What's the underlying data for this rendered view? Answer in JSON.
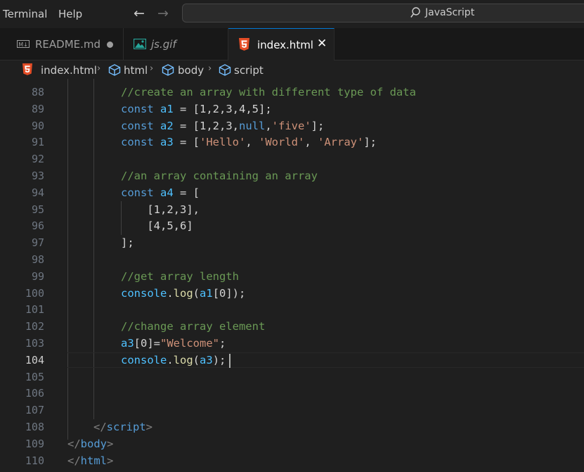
{
  "menu": {
    "terminal": "Terminal",
    "help": "Help"
  },
  "nav": {
    "back": "←",
    "forward": "→"
  },
  "search": {
    "text": "JavaScript"
  },
  "tabs": [
    {
      "label": "README.md",
      "icon": "M↓",
      "state": "modified"
    },
    {
      "label": "js.gif",
      "icon": "image-icon"
    },
    {
      "label": "index.html",
      "icon": "html5-icon",
      "active": true,
      "close": "✕"
    }
  ],
  "breadcrumb": {
    "file": "index.html",
    "items": [
      "html",
      "body",
      "script"
    ],
    "sep": "›"
  },
  "editor": {
    "current_line": "104",
    "lines": [
      {
        "n": "88",
        "parts": [
          {
            "t": "//create an array with different type of data",
            "c": "cm"
          }
        ]
      },
      {
        "n": "89",
        "parts": [
          {
            "t": "const ",
            "c": "kw"
          },
          {
            "t": "a1",
            "c": "vr"
          },
          {
            "t": " = [1,2,3,4,5];",
            "c": "tx"
          }
        ]
      },
      {
        "n": "90",
        "parts": [
          {
            "t": "const ",
            "c": "kw"
          },
          {
            "t": "a2",
            "c": "vr"
          },
          {
            "t": " = [1,2,3,",
            "c": "tx"
          },
          {
            "t": "null",
            "c": "kw"
          },
          {
            "t": ",",
            "c": "tx"
          },
          {
            "t": "'five'",
            "c": "st"
          },
          {
            "t": "];",
            "c": "tx"
          }
        ]
      },
      {
        "n": "91",
        "parts": [
          {
            "t": "const ",
            "c": "kw"
          },
          {
            "t": "a3",
            "c": "vr"
          },
          {
            "t": " = [",
            "c": "tx"
          },
          {
            "t": "'Hello'",
            "c": "st"
          },
          {
            "t": ", ",
            "c": "tx"
          },
          {
            "t": "'World'",
            "c": "st"
          },
          {
            "t": ", ",
            "c": "tx"
          },
          {
            "t": "'Array'",
            "c": "st"
          },
          {
            "t": "];",
            "c": "tx"
          }
        ]
      },
      {
        "n": "92",
        "parts": []
      },
      {
        "n": "93",
        "parts": [
          {
            "t": "//an array containing an array",
            "c": "cm"
          }
        ]
      },
      {
        "n": "94",
        "parts": [
          {
            "t": "const ",
            "c": "kw"
          },
          {
            "t": "a4",
            "c": "vr"
          },
          {
            "t": " = [",
            "c": "tx"
          }
        ]
      },
      {
        "n": "95",
        "parts": [
          {
            "t": "    [1,2,3],",
            "c": "tx"
          }
        ]
      },
      {
        "n": "96",
        "parts": [
          {
            "t": "    [4,5,6]",
            "c": "tx"
          }
        ]
      },
      {
        "n": "97",
        "parts": [
          {
            "t": "];",
            "c": "tx"
          }
        ]
      },
      {
        "n": "98",
        "parts": []
      },
      {
        "n": "99",
        "parts": [
          {
            "t": "//get array length",
            "c": "cm"
          }
        ]
      },
      {
        "n": "100",
        "parts": [
          {
            "t": "console",
            "c": "vr"
          },
          {
            "t": ".",
            "c": "tx"
          },
          {
            "t": "log",
            "c": "fn"
          },
          {
            "t": "(",
            "c": "tx"
          },
          {
            "t": "a1",
            "c": "vr"
          },
          {
            "t": "[0]);",
            "c": "tx"
          }
        ]
      },
      {
        "n": "101",
        "parts": []
      },
      {
        "n": "102",
        "parts": [
          {
            "t": "//change array element",
            "c": "cm"
          }
        ]
      },
      {
        "n": "103",
        "parts": [
          {
            "t": "a3",
            "c": "vr"
          },
          {
            "t": "[0]=",
            "c": "tx"
          },
          {
            "t": "\"Welcome\"",
            "c": "st"
          },
          {
            "t": ";",
            "c": "tx"
          }
        ]
      },
      {
        "n": "104",
        "parts": [
          {
            "t": "console",
            "c": "vr"
          },
          {
            "t": ".",
            "c": "tx"
          },
          {
            "t": "log",
            "c": "fn"
          },
          {
            "t": "(",
            "c": "tx"
          },
          {
            "t": "a3",
            "c": "vr"
          },
          {
            "t": ");",
            "c": "tx"
          }
        ]
      },
      {
        "n": "105",
        "parts": []
      },
      {
        "n": "106",
        "parts": []
      },
      {
        "n": "107",
        "parts": []
      },
      {
        "n": "108",
        "parts": [
          {
            "t": "</",
            "c": "pu"
          },
          {
            "t": "script",
            "c": "tg"
          },
          {
            "t": ">",
            "c": "pu"
          }
        ]
      },
      {
        "n": "109",
        "parts": [
          {
            "t": "</",
            "c": "pu"
          },
          {
            "t": "body",
            "c": "tg"
          },
          {
            "t": ">",
            "c": "pu"
          }
        ]
      },
      {
        "n": "110",
        "parts": [
          {
            "t": "</",
            "c": "pu"
          },
          {
            "t": "html",
            "c": "tg"
          },
          {
            "t": ">",
            "c": "pu"
          }
        ]
      }
    ]
  }
}
